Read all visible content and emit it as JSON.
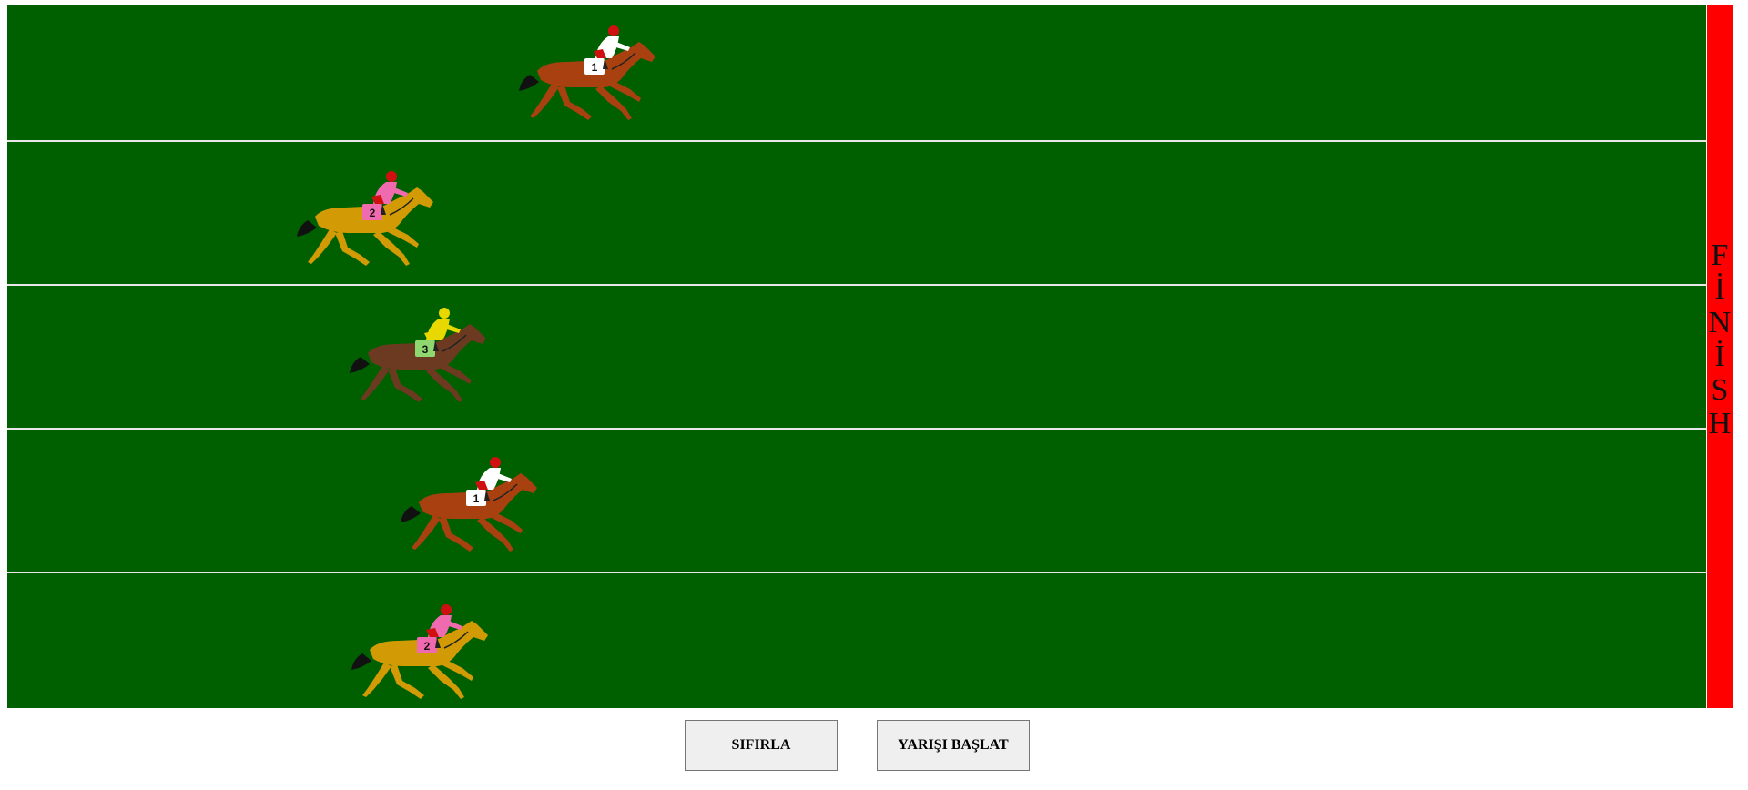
{
  "race": {
    "finish_label": "FİNİSH",
    "finish_letters": [
      "F",
      "İ",
      "N",
      "İ",
      "S",
      "H"
    ],
    "lanes": [
      {
        "horse_number": "1",
        "coat_color": "#a8400f",
        "silk_color": "#ffffff",
        "cap_color": "#d01010",
        "saddle_color": "#ffffff"
      },
      {
        "horse_number": "2",
        "coat_color": "#d29a05",
        "silk_color": "#f06ab0",
        "cap_color": "#d01010",
        "saddle_color": "#f06ab0"
      },
      {
        "horse_number": "3",
        "coat_color": "#6b3a20",
        "silk_color": "#e8d800",
        "cap_color": "#e8d800",
        "saddle_color": "#8fd870"
      },
      {
        "horse_number": "1",
        "coat_color": "#a8400f",
        "silk_color": "#ffffff",
        "cap_color": "#d01010",
        "saddle_color": "#ffffff"
      },
      {
        "horse_number": "2",
        "coat_color": "#d29a05",
        "silk_color": "#f06ab0",
        "cap_color": "#d01010",
        "saddle_color": "#f06ab0"
      }
    ]
  },
  "controls": {
    "reset_label": "SIFIRLA",
    "start_label": "YARIŞI BAŞLAT"
  },
  "colors": {
    "track": "#006000",
    "lane_divider": "#e8e8e8",
    "finish_line": "#ff0000",
    "button_bg": "#efefef"
  }
}
